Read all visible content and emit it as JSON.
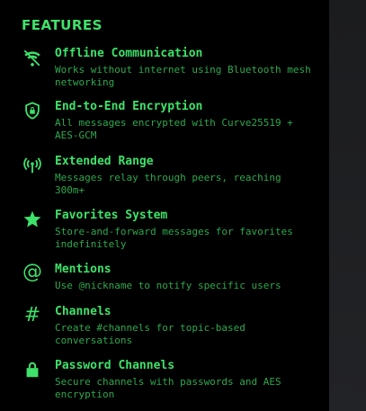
{
  "heading": "FEATURES",
  "colors": {
    "accent": "#3ee26a",
    "muted": "#2ea84e",
    "background": "#000000"
  },
  "features": [
    {
      "title": "Offline Communication",
      "desc": "Works without internet using Bluetooth mesh networking",
      "icon": "wifi-off-icon"
    },
    {
      "title": "End-to-End Encryption",
      "desc": "All messages encrypted with Curve25519 + AES-GCM",
      "icon": "shield-lock-icon"
    },
    {
      "title": "Extended Range",
      "desc": "Messages relay through peers, reaching 300m+",
      "icon": "antenna-icon"
    },
    {
      "title": "Favorites System",
      "desc": "Store-and-forward messages for favorites indefinitely",
      "icon": "star-icon"
    },
    {
      "title": "Mentions",
      "desc": "Use @nickname to notify specific users",
      "icon": "at-sign-icon"
    },
    {
      "title": "Channels",
      "desc": "Create #channels for topic-based conversations",
      "icon": "hash-icon"
    },
    {
      "title": "Password Channels",
      "desc": "Secure channels with passwords and AES encryption",
      "icon": "lock-icon"
    }
  ]
}
